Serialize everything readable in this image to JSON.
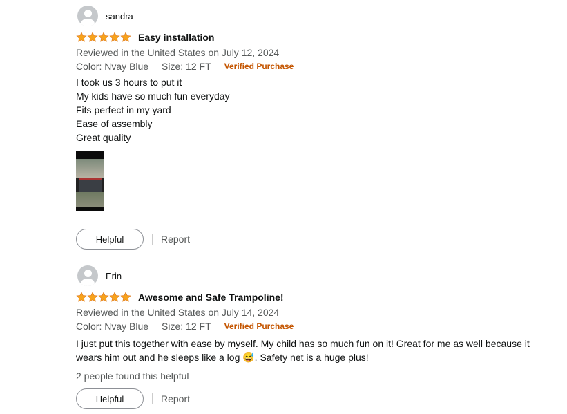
{
  "reviews": [
    {
      "reviewer": "sandra",
      "rating": 5,
      "title": "Easy installation",
      "date_text": "Reviewed in the United States on July 12, 2024",
      "color_text": "Color: Nvay Blue",
      "size_text": "Size: 12 FT",
      "verified_text": "Verified Purchase",
      "body_lines": [
        "I took us 3 hours to put it",
        "My kids have so much fun everyday",
        "Fits perfect in my yard",
        "Ease of assembly",
        "Great quality"
      ],
      "helpful_label": "Helpful",
      "report_label": "Report"
    },
    {
      "reviewer": "Erin",
      "rating": 5,
      "title": "Awesome and Safe Trampoline!",
      "date_text": "Reviewed in the United States on July 14, 2024",
      "color_text": "Color: Nvay Blue",
      "size_text": "Size: 12 FT",
      "verified_text": "Verified Purchase",
      "body_line_1": "I just put this together with ease by myself. My child has so much fun on it! Great for me as well because it",
      "body_line_2": "wears him out and he sleeps like a log 😅. Safety net is a huge plus!",
      "helpful_count_text": "2 people found this helpful",
      "helpful_label": "Helpful",
      "report_label": "Report"
    }
  ],
  "colors": {
    "star": "#F7A31C",
    "verified": "#C45500",
    "meta_text": "#565959"
  }
}
